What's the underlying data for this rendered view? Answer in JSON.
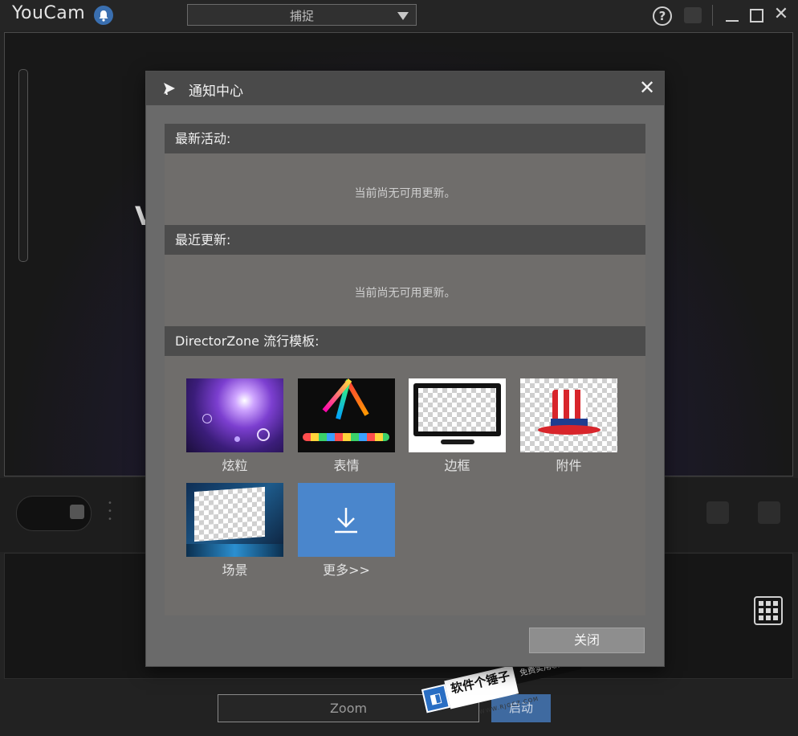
{
  "app": {
    "name": "YouCam",
    "mode": "捕捉"
  },
  "dialog": {
    "title": "通知中心",
    "sections": [
      {
        "heading": "最新活动:",
        "message": "当前尚无可用更新。"
      },
      {
        "heading": "最近更新:",
        "message": "当前尚无可用更新。"
      },
      {
        "heading": "DirectorZone 流行模板:"
      }
    ],
    "templates": [
      {
        "label": "炫粒",
        "icon": "particles-thumbnail"
      },
      {
        "label": "表情",
        "icon": "emotion-thumbnail"
      },
      {
        "label": "边框",
        "icon": "frame-thumbnail"
      },
      {
        "label": "附件",
        "icon": "accessory-hat-thumbnail"
      },
      {
        "label": "场景",
        "icon": "scene-thumbnail"
      },
      {
        "label": "更多>>",
        "icon": "download-icon"
      }
    ],
    "close_label": "关闭"
  },
  "footer": {
    "zoom_label": "Zoom",
    "start_label": "启动"
  },
  "watermark": {
    "brand": "软件个锤子",
    "slogan": "免费实用软件站",
    "domain": "WWW.RJGCZ.COM"
  },
  "colors": {
    "accent_blue": "#4a86cc",
    "dialog_bg": "#6a6a6a",
    "section_header": "#4c4c4c"
  }
}
